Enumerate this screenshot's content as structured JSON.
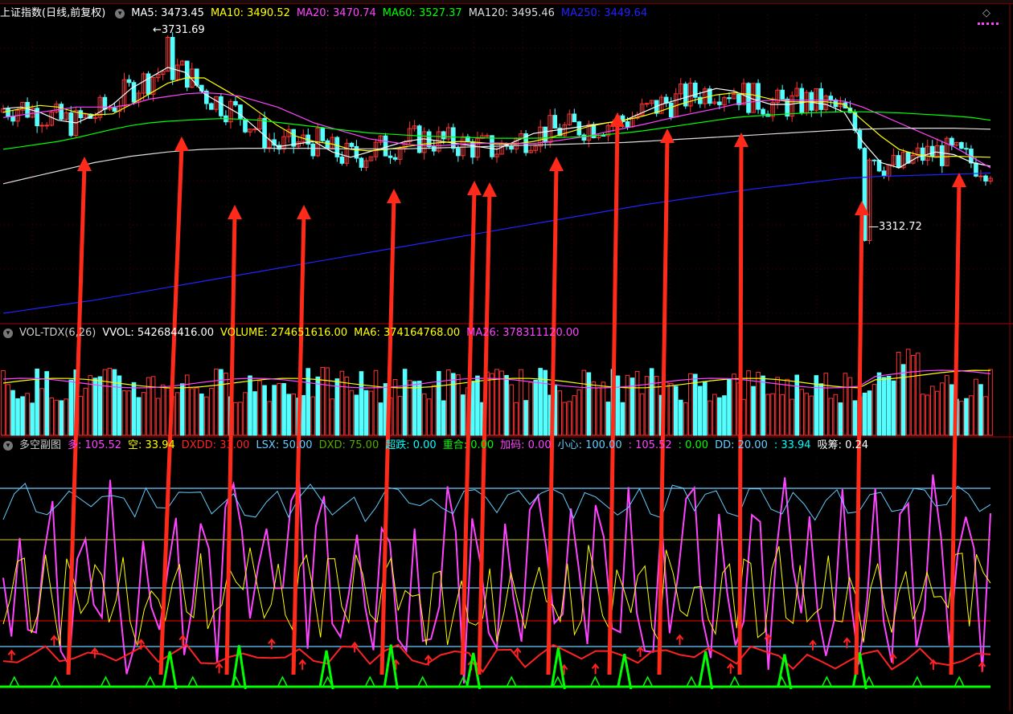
{
  "price_panel": {
    "title": "上证指数(日线,前复权)",
    "ma_labels": [
      {
        "text": "MA5: 3473.45",
        "color": "#ffffff"
      },
      {
        "text": "MA10: 3490.52",
        "color": "#ffff00"
      },
      {
        "text": "MA20: 3470.74",
        "color": "#ff44ff"
      },
      {
        "text": "MA60: 3527.37",
        "color": "#00ff00"
      },
      {
        "text": "MA120: 3495.46",
        "color": "#dddddd"
      },
      {
        "text": "MA250: 3449.64",
        "color": "#2222ff"
      }
    ],
    "high_label": "3731.69",
    "low_label": "3312.72"
  },
  "volume_panel": {
    "labels": [
      {
        "text": "VOL-TDX(6,26)",
        "color": "#cccccc"
      },
      {
        "text": "VVOL: 542684416.00",
        "color": "#ffffff"
      },
      {
        "text": "VOLUME: 274651616.00",
        "color": "#ffff00"
      },
      {
        "text": "MA6: 374164768.00",
        "color": "#ffff00"
      },
      {
        "text": "MA26: 378311120.00",
        "color": "#ff44ff"
      }
    ]
  },
  "indicator_panel": {
    "labels": [
      {
        "text": "多空副图",
        "color": "#cccccc"
      },
      {
        "text": "多: 105.52",
        "color": "#ff44ff"
      },
      {
        "text": "空: 33.94",
        "color": "#ffff00"
      },
      {
        "text": "DXDD: 33.00",
        "color": "#ff2222"
      },
      {
        "text": "LSX: 50.00",
        "color": "#66ccff"
      },
      {
        "text": "DXD: 75.00",
        "color": "#55aa00"
      },
      {
        "text": "超跌: 0.00",
        "color": "#00ffff"
      },
      {
        "text": "重合: 0.00",
        "color": "#00ff00"
      },
      {
        "text": "加码: 0.00",
        "color": "#ff44ff"
      },
      {
        "text": "小心: 100.00",
        "color": "#66ccff"
      },
      {
        "text": ": 105.52",
        "color": "#ff44ff"
      },
      {
        "text": ": 0.00",
        "color": "#00ff00"
      },
      {
        "text": "DD: 20.00",
        "color": "#66ccff"
      },
      {
        "text": ": 33.94",
        "color": "#00ffff"
      },
      {
        "text": "吸筹: 0.24",
        "color": "#ffffff"
      }
    ]
  },
  "chart_data": {
    "type": "candlestick",
    "ylim": [
      3312.72,
      3731.69
    ],
    "ma_series": [
      {
        "name": "MA5",
        "color": "#ffffff",
        "values": [
          3582,
          3585,
          3575,
          3560,
          3555,
          3570,
          3590,
          3620,
          3640,
          3660,
          3650,
          3610,
          3590,
          3570,
          3540,
          3510,
          3515,
          3520,
          3500,
          3490,
          3500,
          3510,
          3520,
          3525,
          3520,
          3515,
          3510,
          3505,
          3520,
          3535,
          3540,
          3545,
          3550,
          3555,
          3560,
          3575,
          3590,
          3600,
          3610,
          3620,
          3615,
          3600,
          3590,
          3590,
          3595,
          3590,
          3575,
          3520,
          3480,
          3470,
          3490,
          3500,
          3495,
          3480,
          3473
        ]
      },
      {
        "name": "MA10",
        "color": "#ffff00",
        "values": [
          3575,
          3582,
          3588,
          3585,
          3575,
          3570,
          3572,
          3590,
          3610,
          3630,
          3640,
          3640,
          3620,
          3600,
          3575,
          3550,
          3530,
          3520,
          3515,
          3505,
          3502,
          3505,
          3510,
          3515,
          3518,
          3520,
          3518,
          3515,
          3515,
          3520,
          3528,
          3538,
          3548,
          3555,
          3560,
          3568,
          3578,
          3590,
          3600,
          3608,
          3612,
          3608,
          3600,
          3595,
          3595,
          3595,
          3590,
          3560,
          3530,
          3505,
          3495,
          3490,
          3492,
          3491,
          3490
        ]
      },
      {
        "name": "MA20",
        "color": "#ff44ff",
        "values": [
          3565,
          3570,
          3575,
          3580,
          3585,
          3585,
          3585,
          3590,
          3600,
          3605,
          3610,
          3612,
          3610,
          3605,
          3595,
          3585,
          3570,
          3555,
          3545,
          3535,
          3525,
          3520,
          3515,
          3512,
          3512,
          3515,
          3516,
          3517,
          3516,
          3516,
          3520,
          3525,
          3530,
          3538,
          3545,
          3552,
          3560,
          3568,
          3575,
          3582,
          3590,
          3595,
          3598,
          3598,
          3598,
          3598,
          3596,
          3585,
          3570,
          3555,
          3540,
          3525,
          3510,
          3490,
          3470
        ]
      },
      {
        "name": "MA60",
        "color": "#00ff00",
        "values": [
          3505,
          3510,
          3515,
          3520,
          3527,
          3535,
          3543,
          3550,
          3555,
          3558,
          3560,
          3562,
          3563,
          3562,
          3560,
          3556,
          3552,
          3548,
          3544,
          3540,
          3536,
          3534,
          3532,
          3530,
          3529,
          3528,
          3527,
          3526,
          3526,
          3526,
          3527,
          3528,
          3530,
          3533,
          3536,
          3540,
          3545,
          3550,
          3555,
          3560,
          3565,
          3568,
          3570,
          3572,
          3574,
          3575,
          3576,
          3576,
          3575,
          3574,
          3572,
          3570,
          3568,
          3565,
          3560
        ]
      },
      {
        "name": "MA120",
        "color": "#dddddd",
        "values": [
          3440,
          3448,
          3456,
          3464,
          3472,
          3480,
          3486,
          3492,
          3496,
          3500,
          3503,
          3505,
          3506,
          3507,
          3507,
          3507,
          3507,
          3507,
          3506,
          3506,
          3506,
          3506,
          3506,
          3507,
          3508,
          3509,
          3510,
          3511,
          3512,
          3513,
          3514,
          3515,
          3516,
          3517,
          3518,
          3520,
          3522,
          3524,
          3526,
          3528,
          3530,
          3532,
          3534,
          3536,
          3538,
          3540,
          3542,
          3543,
          3544,
          3545,
          3545,
          3545,
          3545,
          3544,
          3543
        ]
      },
      {
        "name": "MA250",
        "color": "#2222ff",
        "values": [
          3195,
          3200,
          3205,
          3210,
          3215,
          3220,
          3226,
          3232,
          3238,
          3244,
          3250,
          3256,
          3262,
          3268,
          3274,
          3280,
          3286,
          3292,
          3298,
          3304,
          3310,
          3316,
          3322,
          3328,
          3334,
          3340,
          3346,
          3352,
          3358,
          3364,
          3370,
          3376,
          3382,
          3388,
          3394,
          3400,
          3405,
          3410,
          3415,
          3420,
          3425,
          3430,
          3434,
          3438,
          3442,
          3446,
          3450,
          3452,
          3454,
          3455,
          3456,
          3457,
          3458,
          3459,
          3460
        ]
      }
    ]
  },
  "colors": {
    "up": "#ff3333",
    "down": "#55ffff",
    "frame": "#8a0000",
    "arrow": "#ff2a1a"
  }
}
